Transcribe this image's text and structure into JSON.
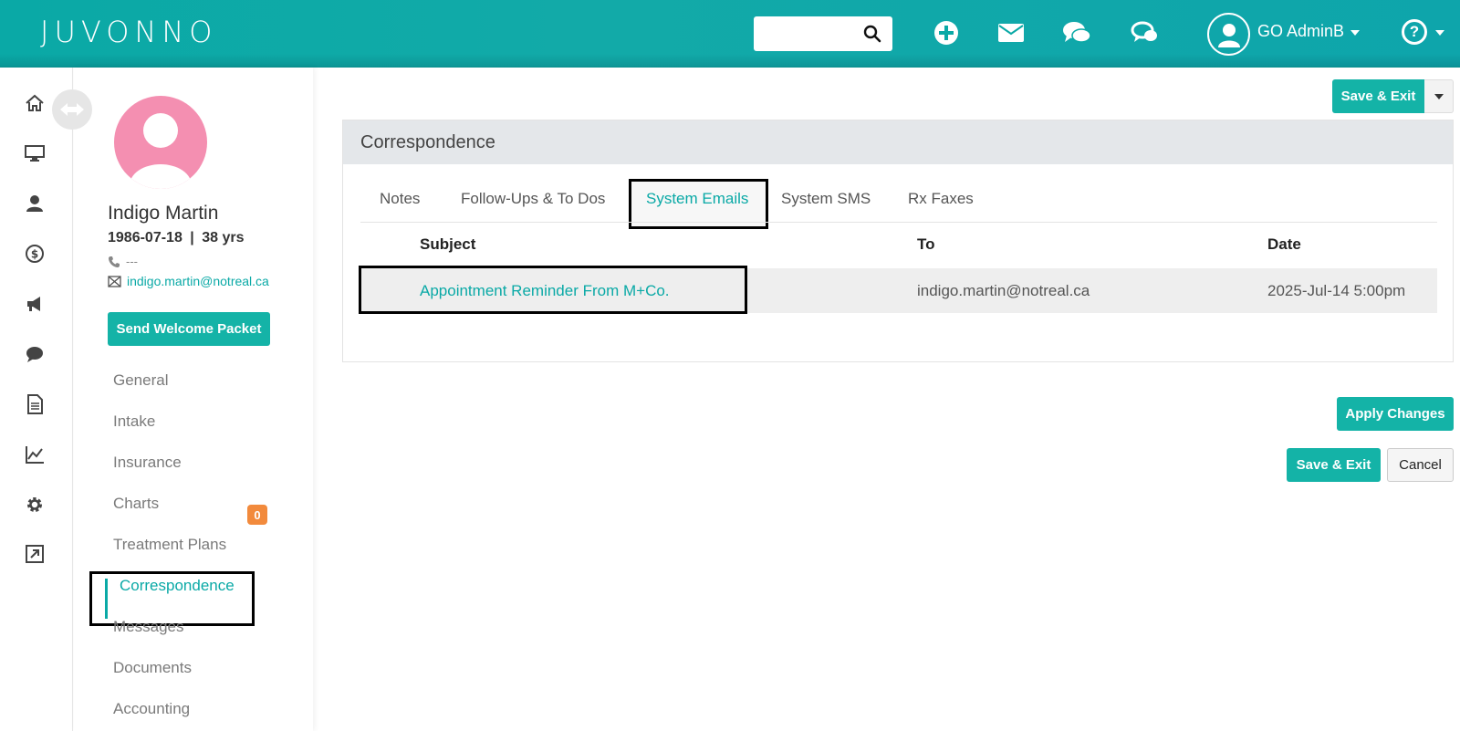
{
  "header": {
    "logo": "JUVONNO",
    "search_placeholder": "",
    "user_name": "GO AdminB",
    "help_symbol": "?"
  },
  "icons": {
    "top": [
      "search-icon",
      "add-icon",
      "mail-icon",
      "chat-icon",
      "live-chat-icon",
      "user-avatar-icon",
      "help-icon"
    ],
    "rail": [
      "home-icon",
      "monitor-icon",
      "clients-icon",
      "dollar-icon",
      "megaphone-icon",
      "chat-bubble-icon",
      "document-icon",
      "chart-icon",
      "gear-icon",
      "external-link-icon"
    ]
  },
  "patient": {
    "name": "Indigo Martin",
    "dob": "1986-07-18",
    "separator": "|",
    "age": "38 yrs",
    "phone": "---",
    "email": "indigo.martin@notreal.ca",
    "welcome_button": "Send Welcome Packet"
  },
  "sidebar_nav": [
    {
      "label": "General"
    },
    {
      "label": "Intake"
    },
    {
      "label": "Insurance"
    },
    {
      "label": "Charts",
      "badge": "0"
    },
    {
      "label": "Treatment Plans"
    },
    {
      "label": "Correspondence",
      "active": true
    },
    {
      "label": "Messages"
    },
    {
      "label": "Documents"
    },
    {
      "label": "Accounting"
    }
  ],
  "actions": {
    "save_exit_top": "Save & Exit",
    "apply_changes": "Apply Changes",
    "save_exit_bottom": "Save & Exit",
    "cancel": "Cancel"
  },
  "panel": {
    "title": "Correspondence",
    "tabs": [
      "Notes",
      "Follow-Ups & To Dos",
      "System Emails",
      "System SMS",
      "Rx Faxes"
    ],
    "active_tab": "System Emails",
    "columns": [
      "Subject",
      "To",
      "Date"
    ],
    "rows": [
      {
        "subject": "Appointment Reminder From M+Co.",
        "to": "indigo.martin@notreal.ca",
        "date": "2025-Jul-14 5:00pm"
      }
    ]
  },
  "colors": {
    "accent": "#0aa9a6",
    "button": "#14b3a7",
    "badge": "#f28a3c",
    "avatar": "#f48fb1"
  }
}
